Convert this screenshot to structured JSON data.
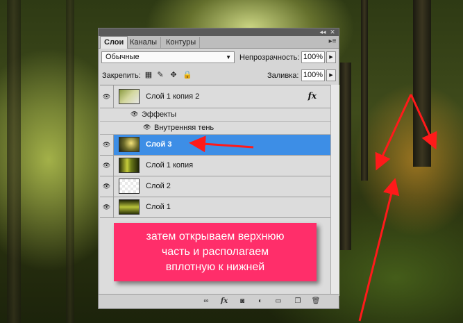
{
  "panel": {
    "tabs": [
      {
        "label": "Слои",
        "active": true
      },
      {
        "label": "Каналы",
        "active": false
      },
      {
        "label": "Контуры",
        "active": false
      }
    ],
    "blend_mode": "Обычные",
    "opacity_label": "Непрозрачность:",
    "opacity_value": "100%",
    "lock_label": "Закрепить:",
    "fill_label": "Заливка:",
    "fill_value": "100%"
  },
  "layers": [
    {
      "name": "Слой 1 копия 2",
      "has_fx": true,
      "fx_label": "fx",
      "selected": false
    },
    {
      "name": "Слой 3",
      "selected": true
    },
    {
      "name": "Слой 1 копия",
      "selected": false
    },
    {
      "name": "Слой 2",
      "selected": false
    },
    {
      "name": "Слой 1",
      "selected": false
    }
  ],
  "effects": {
    "group_label": "Эффекты",
    "items": [
      "Внутренняя тень"
    ]
  },
  "callout": {
    "lines": [
      "затем открываем верхнюю",
      "часть и располагаем",
      "вплотную к нижней"
    ]
  },
  "colors": {
    "selection": "#3d8ee6",
    "callout": "#ff2e6a",
    "arrow": "#ff1a1a"
  }
}
